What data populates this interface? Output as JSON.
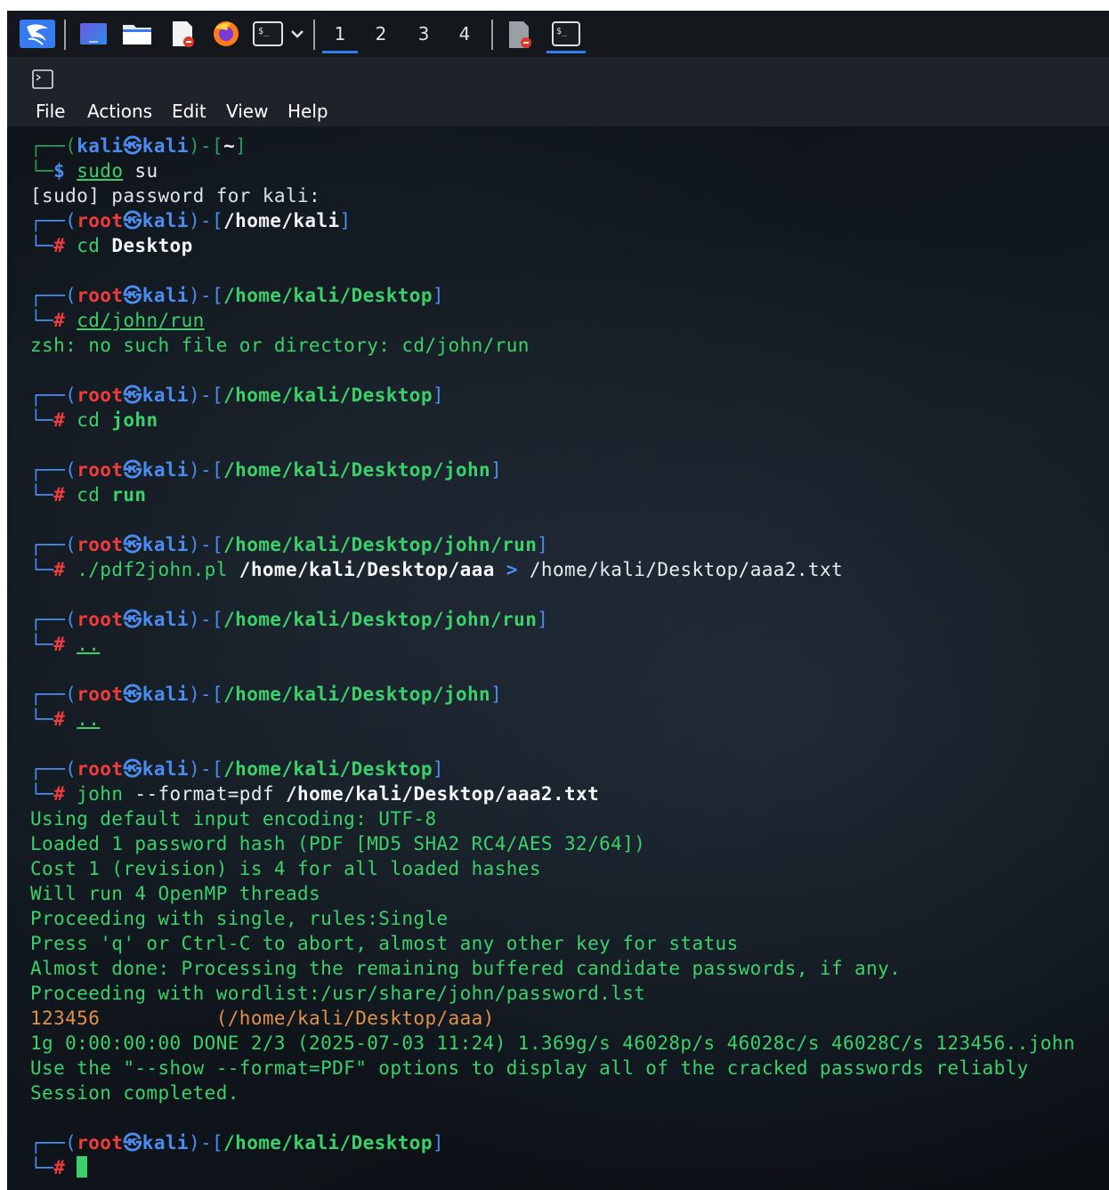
{
  "taskbar": {
    "workspaces": [
      "1",
      "2",
      "3",
      "4"
    ],
    "active_workspace": "1",
    "icons": [
      "kali-dragon-icon",
      "desktop-icon",
      "file-manager-icon",
      "text-editor-icon",
      "firefox-icon",
      "terminal-icon",
      "chevron-down-icon",
      "pdf-task-icon",
      "terminal-task-icon"
    ]
  },
  "menubar": {
    "items": [
      "File",
      "Actions",
      "Edit",
      "View",
      "Help"
    ]
  },
  "terminal": {
    "user_kali": "kali",
    "user_root": "root",
    "host": "kali",
    "at": "㉿",
    "p_home_tilde": "~",
    "p_home_kali": "/home/kali",
    "p_desktop": "/home/kali/Desktop",
    "p_john": "/home/kali/Desktop/john",
    "p_run": "/home/kali/Desktop/john/run",
    "cmd1_a": "sudo",
    "cmd1_b": " su",
    "sudo_prompt": "[sudo] password for kali:",
    "cmd2_a": "cd",
    "cmd2_b": " Desktop",
    "cmd3": "cd/john/run",
    "err3": "zsh: no such file or directory: cd/john/run",
    "cmd4_a": "cd",
    "cmd4_b": " john",
    "cmd5_a": "cd",
    "cmd5_b": " run",
    "cmd6_a": "./pdf2john.pl",
    "cmd6_b": " /home/kali/Desktop/aaa",
    "cmd6_c": " > ",
    "cmd6_d": "/home/kali/Desktop/aaa2.txt",
    "cmd7": "..",
    "cmd8": "..",
    "cmd9_a": "john",
    "cmd9_b": " --format=pdf",
    "cmd9_c": " /home/kali/Desktop/aaa2.txt",
    "out": [
      "Using default input encoding: UTF-8",
      "Loaded 1 password hash (PDF [MD5 SHA2 RC4/AES 32/64])",
      "Cost 1 (revision) is 4 for all loaded hashes",
      "Will run 4 OpenMP threads",
      "Proceeding with single, rules:Single",
      "Press 'q' or Ctrl-C to abort, almost any other key for status",
      "Almost done: Processing the remaining buffered candidate passwords, if any.",
      "Proceeding with wordlist:/usr/share/john/password.lst"
    ],
    "found_pw": "123456",
    "found_file": "          (/home/kali/Desktop/aaa)",
    "stats": "1g 0:00:00:00 DONE 2/3 (2025-07-03 11:24) 1.369g/s 46028p/s 46028c/s 46028C/s 123456..john",
    "show_hint": "Use the \"--show --format=PDF\" options to display all of the cracked passwords reliably",
    "session": "Session completed."
  }
}
